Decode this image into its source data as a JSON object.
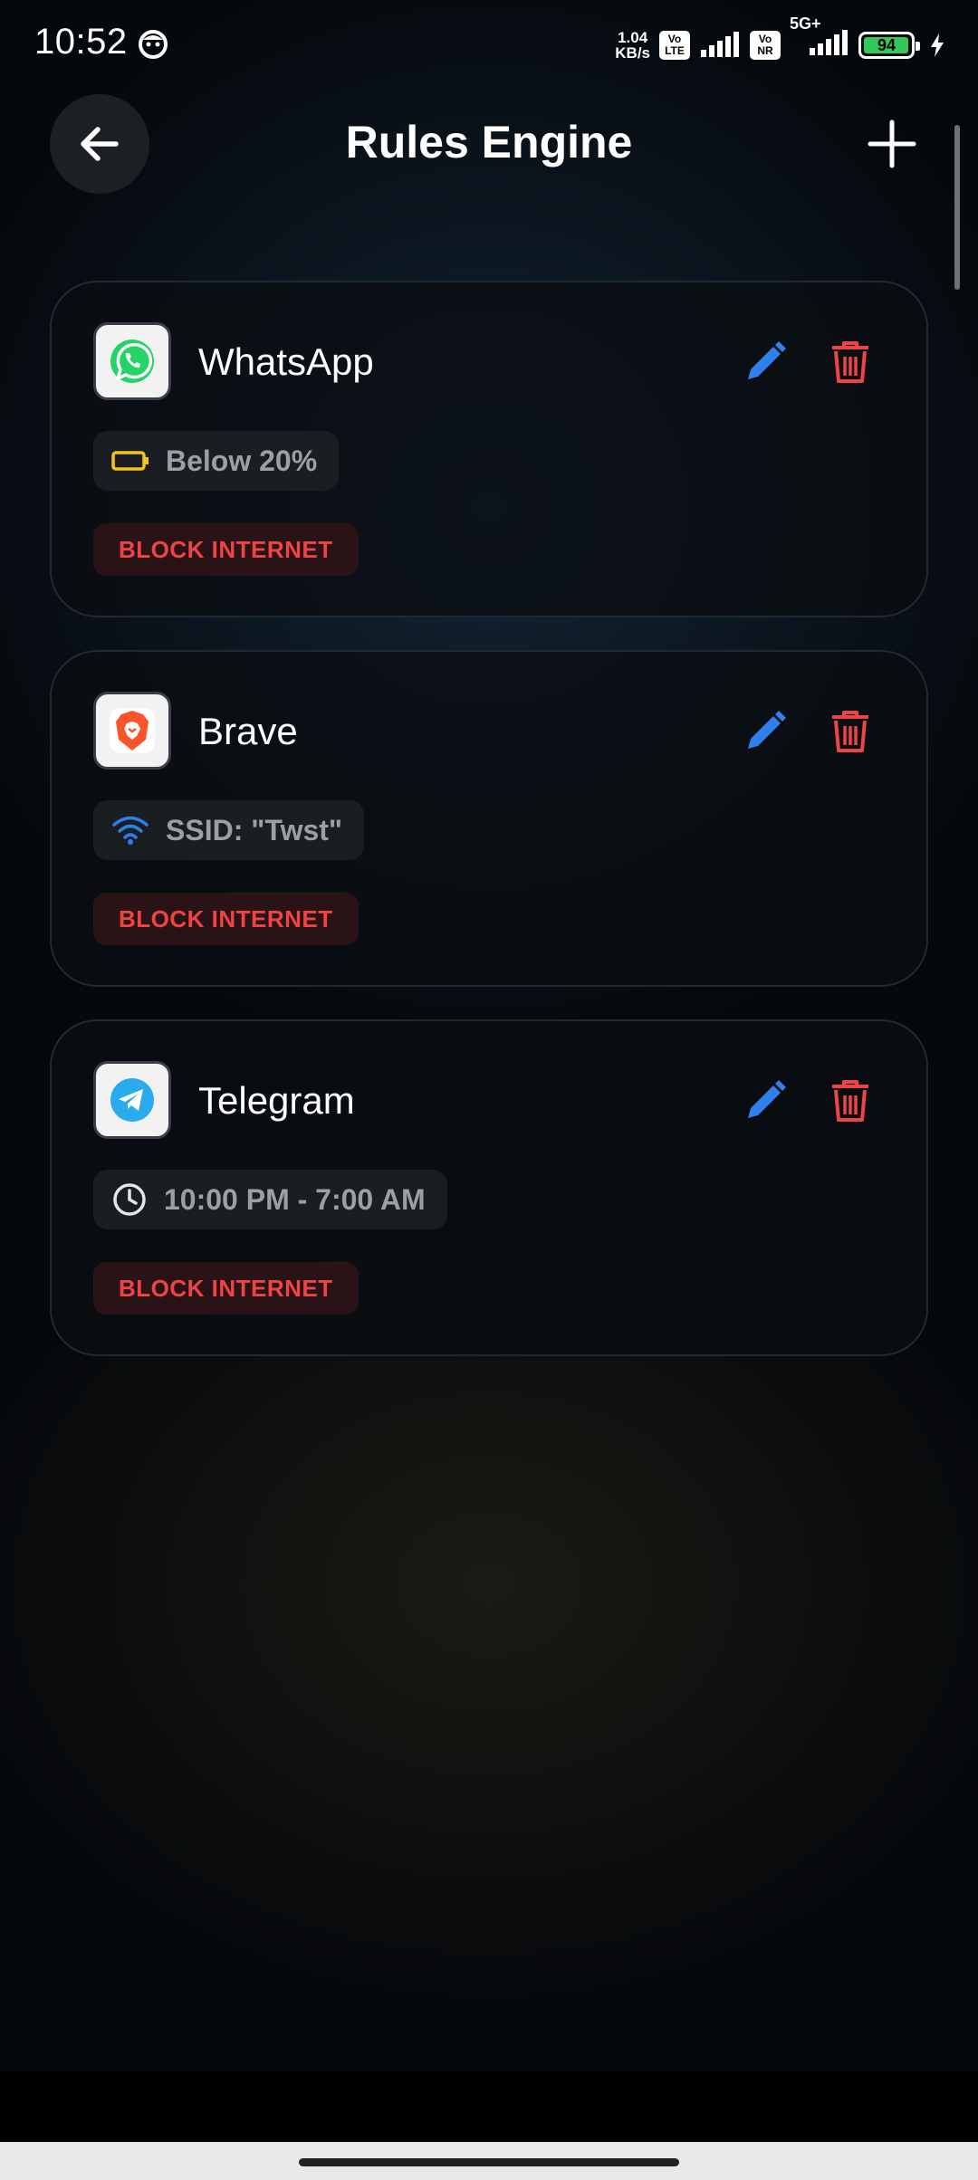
{
  "status_bar": {
    "time": "10:52",
    "net_speed_value": "1.04",
    "net_speed_unit": "KB/s",
    "volte1": "Vo LTE",
    "volte2": "Vo NR",
    "network": "5G+",
    "battery": "94"
  },
  "header": {
    "title": "Rules Engine",
    "back_icon": "arrow-left-icon",
    "add_icon": "plus-icon"
  },
  "colors": {
    "accent_blue": "#2f80ed",
    "danger_red": "#ef4444",
    "battery_yellow": "#f5c518",
    "card_bg": "#0a0e12"
  },
  "rules": [
    {
      "app": "WhatsApp",
      "icon": "whatsapp-icon",
      "condition_icon": "battery-icon",
      "condition": "Below 20%",
      "action": "BLOCK INTERNET"
    },
    {
      "app": "Brave",
      "icon": "brave-icon",
      "condition_icon": "wifi-icon",
      "condition": "SSID: \"Twst\"",
      "action": "BLOCK INTERNET"
    },
    {
      "app": "Telegram",
      "icon": "telegram-icon",
      "condition_icon": "clock-icon",
      "condition": "10:00 PM - 7:00 AM",
      "action": "BLOCK INTERNET"
    }
  ]
}
